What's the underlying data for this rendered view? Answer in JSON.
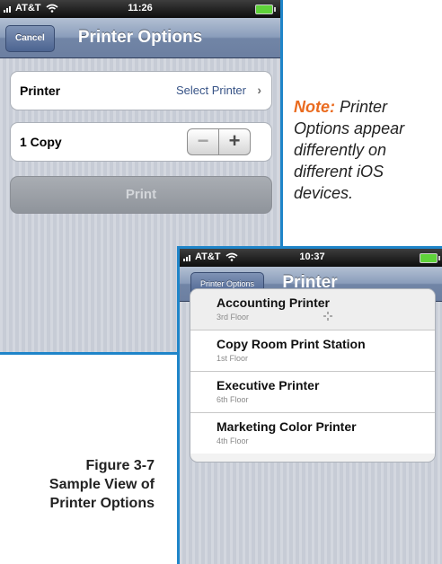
{
  "phone1": {
    "status": {
      "carrier": "AT&T",
      "time": "11:26"
    },
    "nav": {
      "cancel_label": "Cancel",
      "title": "Printer Options"
    },
    "printer_row": {
      "label": "Printer",
      "value": "Select Printer"
    },
    "copies_row": {
      "label": "1 Copy",
      "minus": "−",
      "plus": "+"
    },
    "print_button": "Print"
  },
  "note": {
    "label": "Note:",
    "text": "Printer Options appear differently on different iOS devices."
  },
  "phone2": {
    "status": {
      "carrier": "AT&T",
      "time": "10:37"
    },
    "nav": {
      "back_label": "Printer Options",
      "title": "Printer"
    },
    "printers": [
      {
        "name": "Accounting Printer",
        "floor": "3rd Floor"
      },
      {
        "name": "Copy Room Print Station",
        "floor": "1st Floor"
      },
      {
        "name": "Executive Printer",
        "floor": "6th Floor"
      },
      {
        "name": "Marketing Color Printer",
        "floor": "4th Floor"
      }
    ]
  },
  "caption": {
    "line1": "Figure 3-7",
    "line2": "Sample View of",
    "line3": "Printer Options"
  },
  "colors": {
    "accent": "#ea6b1f",
    "frame": "#1f85c9"
  }
}
